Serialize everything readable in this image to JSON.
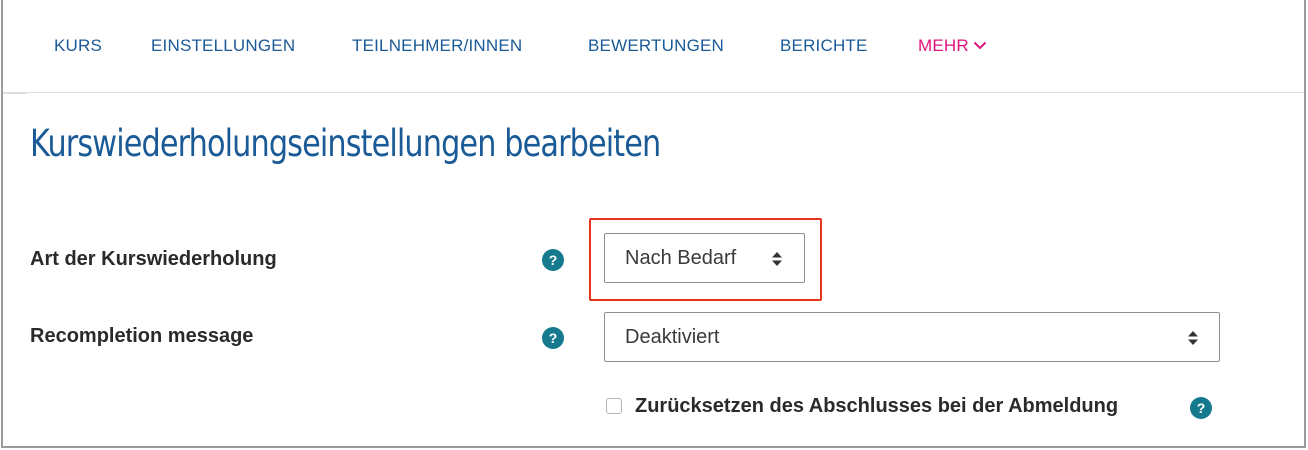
{
  "nav": {
    "items": [
      {
        "label": "KURS"
      },
      {
        "label": "EINSTELLUNGEN"
      },
      {
        "label": "TEILNEHMER/INNEN"
      },
      {
        "label": "BEWERTUNGEN"
      },
      {
        "label": "BERICHTE"
      }
    ],
    "more_label": "MEHR"
  },
  "page": {
    "title": "Kurswiederholungseinstellungen bearbeiten"
  },
  "form": {
    "recurrence_type": {
      "label": "Art der Kurswiederholung",
      "value": "Nach Bedarf"
    },
    "recompletion_message": {
      "label": "Recompletion message",
      "value": "Deaktiviert"
    },
    "reset_on_unenrol": {
      "label": "Zurücksetzen des Abschlusses bei der Abmeldung",
      "checked": false
    },
    "help_glyph": "?"
  },
  "colors": {
    "link": "#1a5a96",
    "accent": "#e0127d",
    "help": "#167a8f",
    "highlight": "#e8331f"
  }
}
